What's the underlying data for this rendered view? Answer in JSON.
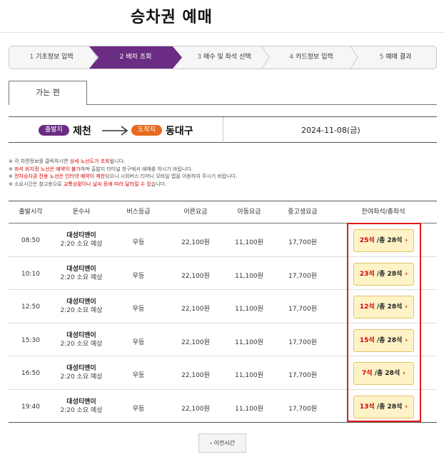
{
  "page": {
    "title": "승차권 예매"
  },
  "steps": [
    {
      "num": "1",
      "label": "기초정보 입력",
      "active": false
    },
    {
      "num": "2",
      "label": "배차 조회",
      "active": true
    },
    {
      "num": "3",
      "label": "매수 및 좌석 선택",
      "active": false
    },
    {
      "num": "4",
      "label": "카드정보 입력",
      "active": false
    },
    {
      "num": "5",
      "label": "예매 결과",
      "active": false
    }
  ],
  "tab": {
    "label": "가는 편"
  },
  "route": {
    "dep_badge": "출발지",
    "dep_city": "제천",
    "arr_badge": "도착지",
    "arr_city": "동대구",
    "date": "2024-11-08(금)"
  },
  "notes": [
    {
      "prefix": "※ 각 차편정보를 클릭하시면 ",
      "highlight": "상세 노선도가 조회",
      "suffix": "됩니다."
    },
    {
      "prefix": "※ ",
      "highlight": "좌석 비지정 노선은 예약이 불가",
      "suffix": "하며 출발지 터미널 창구에서 예매를 하시기 바랍니다."
    },
    {
      "prefix": "※ ",
      "highlight": "전차승차권 전용 노선은 인터넷 예약이 제한",
      "suffix": "되오니 시외버스 티머니 모바일 앱을 이용하여 주시기 바랍니다."
    },
    {
      "prefix": "※ 소요시간은 참고용으로 ",
      "highlight": "교통상황이나 날씨 등에 따라 달라질 수 있",
      "suffix": "습니다."
    }
  ],
  "table": {
    "headers": [
      "출발시각",
      "운수사",
      "버스등급",
      "어른요금",
      "아동요금",
      "중고생요금",
      "잔여좌석/총좌석"
    ],
    "rows": [
      {
        "time": "08:50",
        "company": "대성티앤이",
        "duration": "2:20 소요 예상",
        "grade": "우등",
        "adult": "22,100원",
        "child": "11,100원",
        "student": "17,700원",
        "remaining": "25석",
        "total": "/총 28석"
      },
      {
        "time": "10:10",
        "company": "대성티앤이",
        "duration": "2:20 소요 예상",
        "grade": "우등",
        "adult": "22,100원",
        "child": "11,100원",
        "student": "17,700원",
        "remaining": "23석",
        "total": "/총 28석"
      },
      {
        "time": "12:50",
        "company": "대성티앤이",
        "duration": "2:20 소요 예상",
        "grade": "우등",
        "adult": "22,100원",
        "child": "11,100원",
        "student": "17,700원",
        "remaining": "12석",
        "total": "/총 28석"
      },
      {
        "time": "15:30",
        "company": "대성티앤이",
        "duration": "2:20 소요 예상",
        "grade": "우등",
        "adult": "22,100원",
        "child": "11,100원",
        "student": "17,700원",
        "remaining": "15석",
        "total": "/총 28석"
      },
      {
        "time": "16:50",
        "company": "대성티앤이",
        "duration": "2:20 소요 예상",
        "grade": "우등",
        "adult": "22,100원",
        "child": "11,100원",
        "student": "17,700원",
        "remaining": "7석",
        "total": "/총 28석"
      },
      {
        "time": "19:40",
        "company": "대성티앤이",
        "duration": "2:20 소요 예상",
        "grade": "우등",
        "adult": "22,100원",
        "child": "11,100원",
        "student": "17,700원",
        "remaining": "13석",
        "total": "/총 28석"
      }
    ]
  },
  "prev_button": {
    "label": "이전시간",
    "icon": "chevron-left-icon"
  },
  "colors": {
    "accent": "#6a2d83",
    "arrival": "#e86a1c",
    "highlight": "#d40000",
    "seat_bg": "#fdf3c6"
  }
}
